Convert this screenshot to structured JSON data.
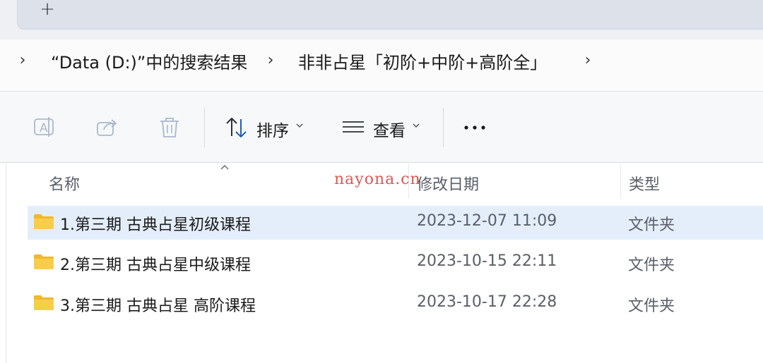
{
  "tabstrip": {
    "new_tab_glyph": "+"
  },
  "breadcrumb": {
    "items": [
      {
        "label": "“Data (D:)”中的搜索结果"
      },
      {
        "label": "非非占星「初阶+中阶+高阶全」"
      }
    ]
  },
  "toolbar": {
    "rename_icon": "rename-icon",
    "share_icon": "share-icon",
    "delete_icon": "trash-icon",
    "sort_label": "排序",
    "view_label": "查看",
    "more_glyph": "•••"
  },
  "list": {
    "columns": {
      "name": "名称",
      "modified": "修改日期",
      "type": "类型"
    },
    "watermark": "nayona.cn",
    "rows": [
      {
        "name": "1.第三期 古典占星初级课程",
        "modified": "2023-12-07 11:09",
        "type": "文件夹"
      },
      {
        "name": "2.第三期 古典占星中级课程",
        "modified": "2023-10-15 22:11",
        "type": "文件夹"
      },
      {
        "name": "3.第三期 古典占星 高阶课程",
        "modified": "2023-10-17 22:28",
        "type": "文件夹"
      }
    ]
  },
  "colors": {
    "folder": "#f5c33b",
    "selection": "#e4eefb",
    "watermark": "#e25555"
  }
}
